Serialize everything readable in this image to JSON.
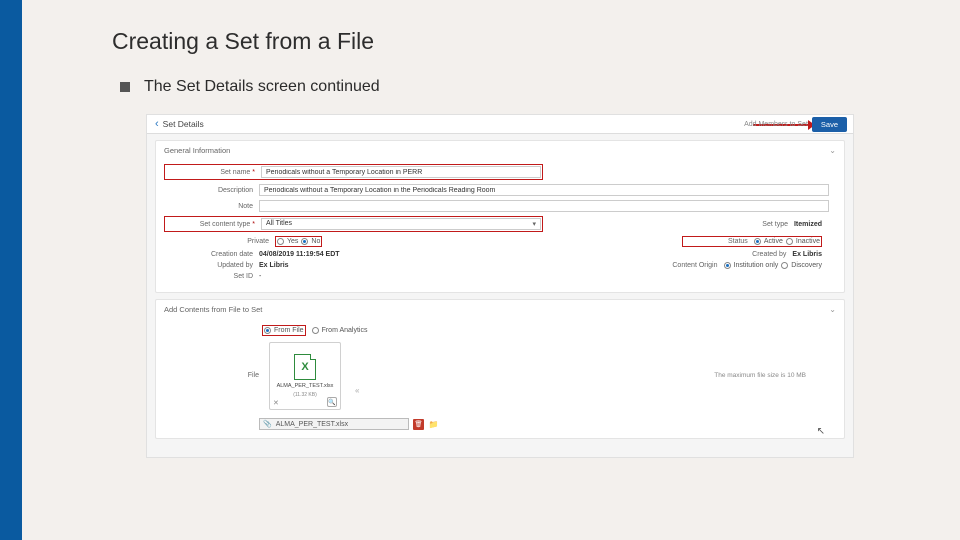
{
  "slide": {
    "title": "Creating a Set from a File",
    "subtitle": "The Set Details screen continued"
  },
  "topbar": {
    "page_title": "Set Details",
    "add_link": "Add Members to Set",
    "save": "Save"
  },
  "general": {
    "header": "General Information",
    "set_name_label": "Set name",
    "set_name_value": "Periodicals without a Temporary Location in PERR",
    "description_label": "Description",
    "description_value": "Periodicals without a Temporary Location in the Periodicals Reading Room",
    "note_label": "Note",
    "content_type_label": "Set content type",
    "content_type_value": "All Titles",
    "private_label": "Private",
    "private_yes": "Yes",
    "private_no": "No",
    "creation_date_label": "Creation date",
    "creation_date_value": "04/08/2019 11:19:54 EDT",
    "updated_by_label": "Updated by",
    "updated_by_value": "Ex Libris",
    "set_id_label": "Set ID",
    "set_id_value": "-",
    "set_type_label": "Set type",
    "set_type_value": "Itemized",
    "status_label": "Status",
    "status_active": "Active",
    "status_inactive": "Inactive",
    "created_by_label": "Created by",
    "created_by_value": "Ex Libris",
    "content_origin_label": "Content Origin",
    "content_origin_inst": "Institution only",
    "content_origin_disc": "Discovery"
  },
  "addc": {
    "header": "Add Contents from File to Set",
    "from_file": "From File",
    "from_analytics": "From Analytics",
    "file_label": "File",
    "file_name": "ALMA_PER_TEST.xlsx",
    "file_size": "(11.32 KB)",
    "max_size": "The maximum file size is 10 MB",
    "chosen_file": "ALMA_PER_TEST.xlsx"
  }
}
